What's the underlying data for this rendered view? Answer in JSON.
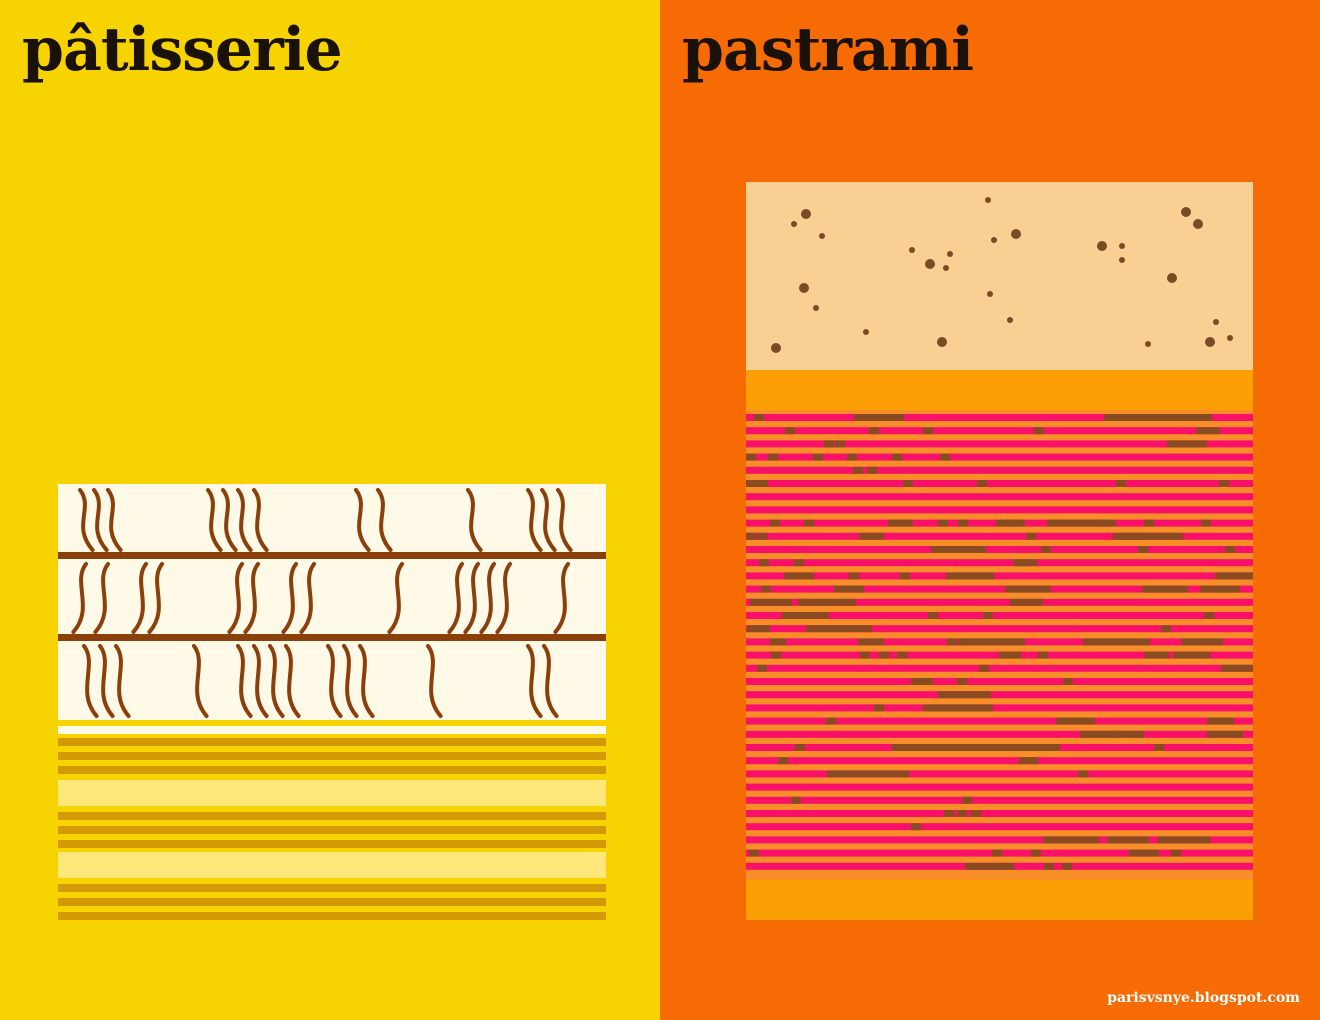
{
  "left": {
    "title": "pâtisserie",
    "colors": {
      "background": "#f8d302",
      "cream": "#fffae8",
      "chocolate": "#8b3f0a",
      "crust": "#d49a05",
      "custard": "#ffe77a",
      "divider": "#f8d302"
    }
  },
  "right": {
    "title": "pastrami",
    "colors": {
      "background": "#f76b05",
      "bread": "#f8d094",
      "bread_speck": "#7a4b24",
      "crust": "#fb9f05",
      "meat": "#f8106a",
      "fat": "#f98d27",
      "pepper": "#8a4b23"
    }
  },
  "footer": {
    "credit": "parisvsnye.blogspot.com"
  },
  "icons": {
    "left_art": "mille-feuille-illustration",
    "right_art": "pastrami-sandwich-illustration"
  }
}
